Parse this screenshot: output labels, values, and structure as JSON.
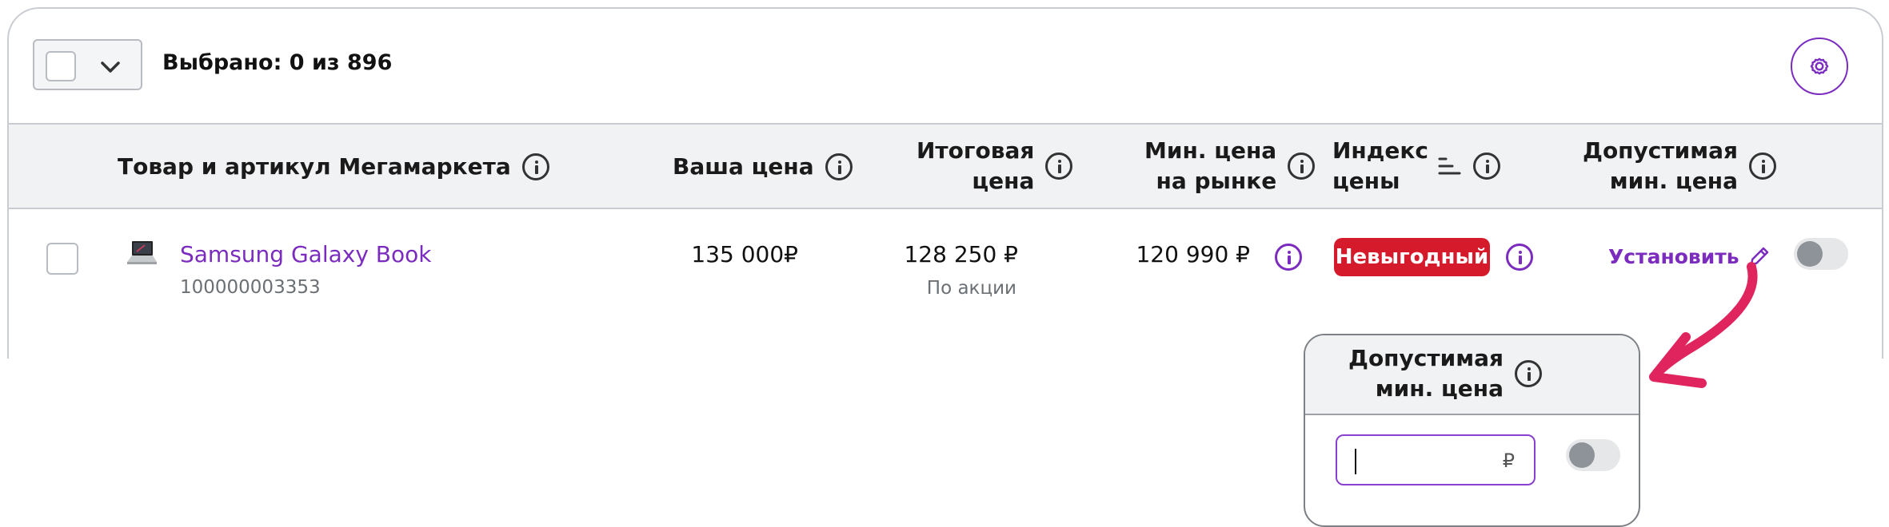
{
  "toolbar": {
    "selected_text": "Выбрано: 0 из 896"
  },
  "columns": {
    "product": "Товар и артикул Мегамаркета",
    "your_price": "Ваша цена",
    "final_price_line1": "Итоговая",
    "final_price_line2": "цена",
    "min_market_line1": "Мин. цена",
    "min_market_line2": "на рынке",
    "price_index_line1": "Индекс",
    "price_index_line2": "цены",
    "allowed_min_line1": "Допустимая",
    "allowed_min_line2": "мин. цена"
  },
  "row": {
    "name": "Samsung Galaxy Book",
    "sku": "100000003353",
    "your_price": "135 000₽",
    "final_price": "128 250 ₽",
    "final_price_note": "По акции",
    "min_market_price": "120 990 ₽",
    "price_index_badge": "Невыгодный",
    "set_label": "Установить"
  },
  "popup": {
    "title_line1": "Допустимая",
    "title_line2": "мин. цена",
    "input_value": "",
    "currency": "₽"
  },
  "colors": {
    "accent": "#7b2cbf",
    "badge_bad": "#d51a2c",
    "annotation_arrow": "#e0245e"
  }
}
